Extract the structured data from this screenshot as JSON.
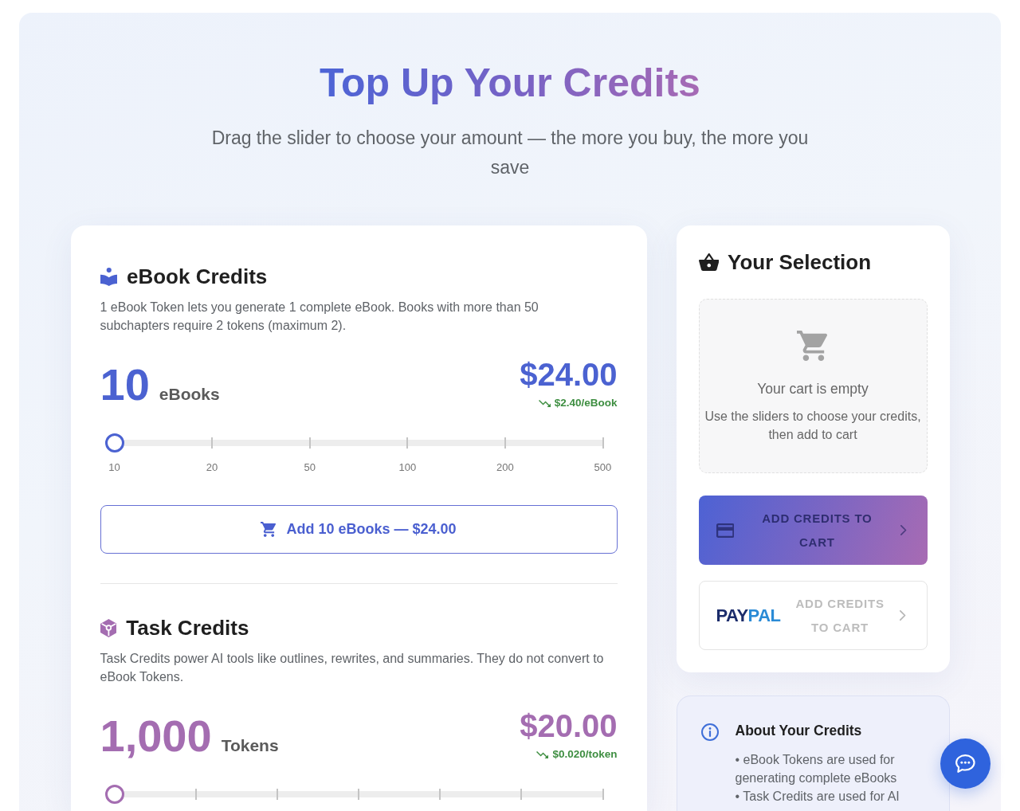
{
  "header": {
    "title": "Top Up Your Credits",
    "subtitle": "Drag the slider to choose your amount — the more you buy, the more you save"
  },
  "products": [
    {
      "kind": "ebook",
      "title": "eBook Credits",
      "description": "1 eBook Token lets you generate 1 complete eBook. Books with more than 50 subchapters require 2 tokens (maximum 2).",
      "quantity": "10",
      "unit": "eBooks",
      "price": "$24.00",
      "unit_price": "$2.40/eBook",
      "slider": {
        "level": 0,
        "tick_labels": [
          "10",
          "20",
          "50",
          "100",
          "200",
          "500"
        ]
      },
      "add_button": "Add 10 eBooks — $24.00"
    },
    {
      "kind": "task",
      "title": "Task Credits",
      "description": "Task Credits power AI tools like outlines, rewrites, and summaries. They do not convert to eBook Tokens.",
      "quantity": "1,000",
      "unit": "Tokens",
      "price": "$20.00",
      "unit_price": "$0.020/token",
      "slider": {
        "level": 0
      }
    }
  ],
  "selection": {
    "title": "Your Selection",
    "empty_cart": {
      "title": "Your cart is empty",
      "text": "Use the sliders to choose your credits, then add to cart"
    },
    "payment_buttons": [
      {
        "kind": "card",
        "label": "ADD CREDITS TO CART",
        "disabled": true
      },
      {
        "kind": "paypal",
        "logo": [
          "PAY",
          "PAL"
        ],
        "label": "ADD CREDITS TO CART",
        "disabled": true
      }
    ]
  },
  "about": {
    "title": "About Your Credits",
    "items": [
      "• eBook Tokens are used for generating complete eBooks",
      "• Task Credits are used for AI"
    ]
  }
}
